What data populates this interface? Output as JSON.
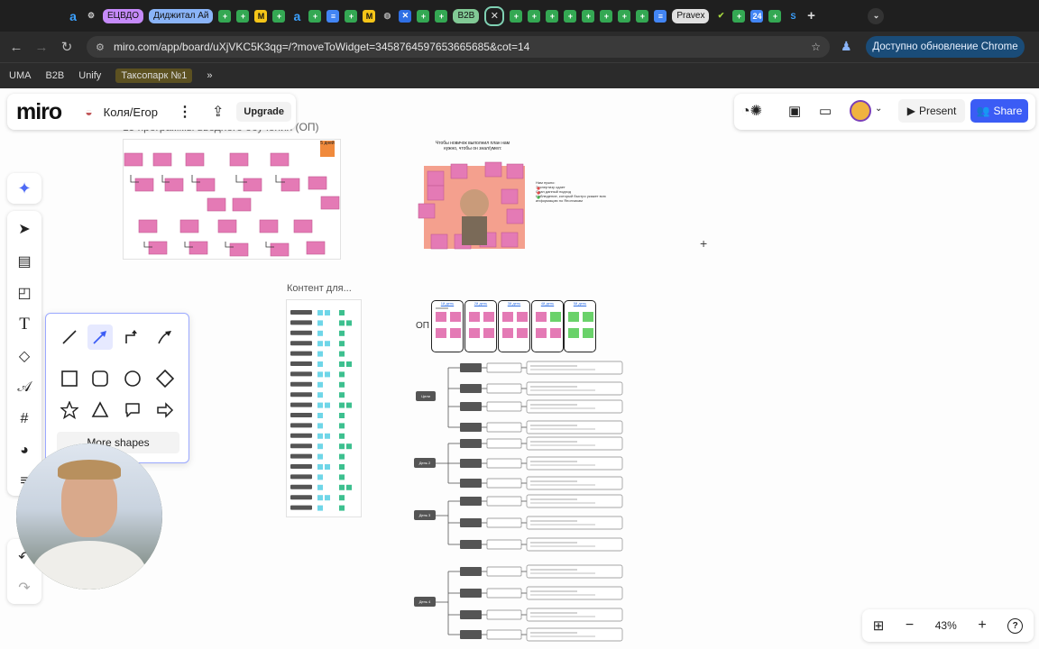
{
  "browser": {
    "tabs": [
      {
        "label": "ЕЦВДО",
        "color": "#c58af9"
      },
      {
        "label": "Диджитал Ай",
        "color": "#8ab4f8"
      },
      {
        "label": "B2B",
        "color": "#81c995"
      },
      {
        "label": "Pravex",
        "color": "#e0e0e0"
      }
    ],
    "new_tab_icon": "plus-icon",
    "url": "miro.com/app/board/uXjVKC5K3qg=/?moveToWidget=3458764597653665685&cot=14",
    "update_button": "Доступно обновление Chrome",
    "bookmarks": [
      "UMA",
      "B2B",
      "Unify",
      "Таксопарк №1"
    ],
    "bookmarks_more": "»"
  },
  "miro": {
    "logo": "miro",
    "board_name": "Коля/Егор",
    "upgrade_label": "Upgrade",
    "present_label": "Present",
    "share_label": "Share",
    "zoom": "43%",
    "zoom_minus": "−",
    "zoom_plus": "+",
    "help": "?",
    "more_shapes_label": "More shapes",
    "accent": "#3b5cf5"
  },
  "board": {
    "frame1_title": "15 программы вводного обучения (ОП)",
    "frame1_badge": "5 дней",
    "frame2_title": "Чтобы новичок выполнил план нам нужно, чтобы он знал/умел:",
    "frame2_notes": [
      "Нам нужно:",
      "Экспертизу сдает",
      "Сдан данный подход",
      "Наблюдение, который быстро укажет всю информацию по Япончикам"
    ],
    "content_title": "Контент для...",
    "op_label": "ОП",
    "days": [
      "1й день",
      "2й день",
      "3й день",
      "4й день",
      "5й день"
    ],
    "tree_roots": [
      "Цели",
      "День 2",
      "День 3",
      "День 4"
    ],
    "sticky_grid1": [
      "Продукт",
      "Гигиена",
      "Отчеты ОП",
      "Продукт"
    ],
    "sticky_grid2": [
      "Продукт",
      "Отчеты ОП"
    ]
  }
}
